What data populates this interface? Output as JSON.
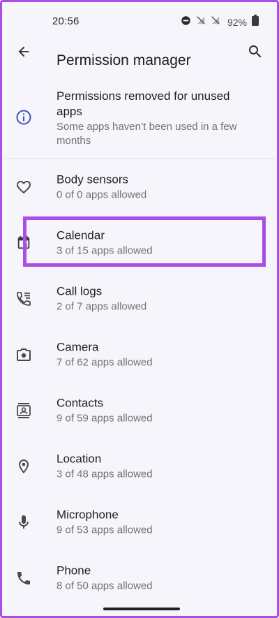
{
  "status_bar": {
    "time": "20:56",
    "battery_percent": "92%",
    "icons": [
      "do-not-disturb-icon",
      "no-signal-icon",
      "no-signal-icon",
      "battery-icon"
    ]
  },
  "app_bar": {
    "title": "Permission manager",
    "back_icon": "arrow-back-icon",
    "search_icon": "search-icon"
  },
  "unused_apps": {
    "title": "Permissions removed for unused apps",
    "subtitle": "Some apps haven’t been used in a few months",
    "icon": "info-icon"
  },
  "permissions": [
    {
      "label": "Body sensors",
      "summary": "0 of 0 apps allowed",
      "icon": "heart-icon"
    },
    {
      "label": "Calendar",
      "summary": "3 of 15 apps allowed",
      "icon": "calendar-icon"
    },
    {
      "label": "Call logs",
      "summary": "2 of 7 apps allowed",
      "icon": "call-log-icon"
    },
    {
      "label": "Camera",
      "summary": "7 of 62 apps allowed",
      "icon": "camera-icon"
    },
    {
      "label": "Contacts",
      "summary": "9 of 59 apps allowed",
      "icon": "contacts-icon"
    },
    {
      "label": "Location",
      "summary": "3 of 48 apps allowed",
      "icon": "location-icon"
    },
    {
      "label": "Microphone",
      "summary": "9 of 53 apps allowed",
      "icon": "microphone-icon"
    },
    {
      "label": "Phone",
      "summary": "8 of 50 apps allowed",
      "icon": "phone-icon"
    }
  ],
  "colors": {
    "highlight": "#a94ee6",
    "info_icon": "#3b55b8",
    "icon": "#4a4a4a"
  }
}
